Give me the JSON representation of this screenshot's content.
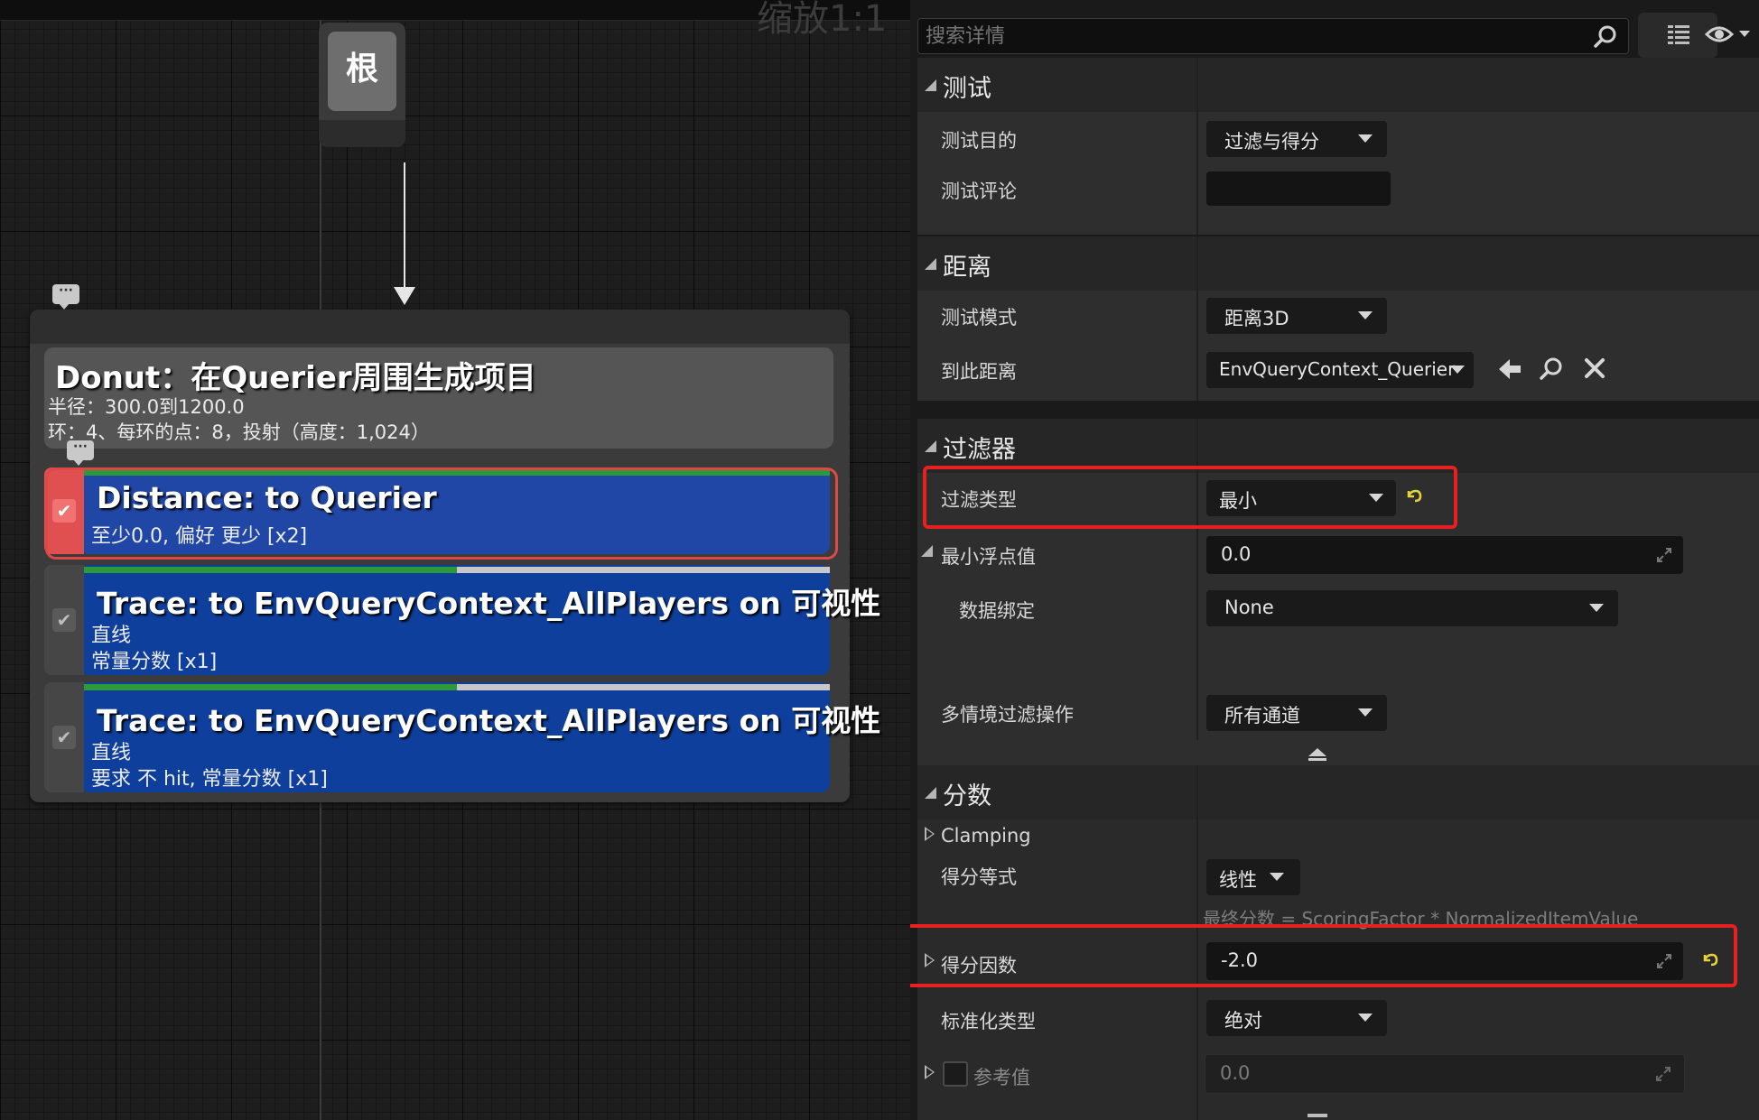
{
  "graph": {
    "zoom_label": "缩放1:1",
    "root_label": "根",
    "generator": {
      "title": "Donut：在Querier周围生成项目",
      "line1": "半径：300.0到1200.0",
      "line2": "环：4、每环的点：8，投射（高度：1,024）"
    },
    "tests": [
      {
        "title": "Distance: to Querier",
        "line1": "至少0.0, 偏好 更少 [x2]",
        "line2": "",
        "selected": true,
        "bar_fraction": 1.0
      },
      {
        "title": "Trace: to EnvQueryContext_AllPlayers on 可视性",
        "line1": "直线",
        "line2": "常量分数 [x1]",
        "selected": false,
        "bar_fraction": 0.5
      },
      {
        "title": "Trace: to EnvQueryContext_AllPlayers on 可视性",
        "line1": "直线",
        "line2": "要求 不 hit, 常量分数 [x1]",
        "selected": false,
        "bar_fraction": 0.5
      }
    ]
  },
  "details": {
    "search_placeholder": "搜索详情",
    "sections": {
      "test": {
        "header": "测试",
        "purpose_label": "测试目的",
        "purpose_value": "过滤与得分",
        "comment_label": "测试评论",
        "comment_value": ""
      },
      "distance": {
        "header": "距离",
        "mode_label": "测试模式",
        "mode_value": "距离3D",
        "to_label": "到此距离",
        "to_value": "EnvQueryContext_Querier"
      },
      "filter": {
        "header": "过滤器",
        "type_label": "过滤类型",
        "type_value": "最小",
        "min_label": "最小浮点值",
        "min_value": "0.0",
        "binding_label": "数据绑定",
        "binding_value": "None",
        "multi_label": "多情境过滤操作",
        "multi_value": "所有通道"
      },
      "score": {
        "header": "分数",
        "clamping_label": "Clamping",
        "equation_label": "得分等式",
        "equation_value": "线性",
        "formula": "最终分数 = ScoringFactor * NormalizedItemValue",
        "factor_label": "得分因数",
        "factor_value": "-2.0",
        "norm_label": "标准化类型",
        "norm_value": "绝对",
        "ref_label": "参考值",
        "ref_value": "0.0"
      }
    }
  },
  "colors": {
    "highlight": "#e82020",
    "test_card": "#0f3f9c",
    "selected_check": "#e05050",
    "reset_arrow": "#e7d23a"
  }
}
